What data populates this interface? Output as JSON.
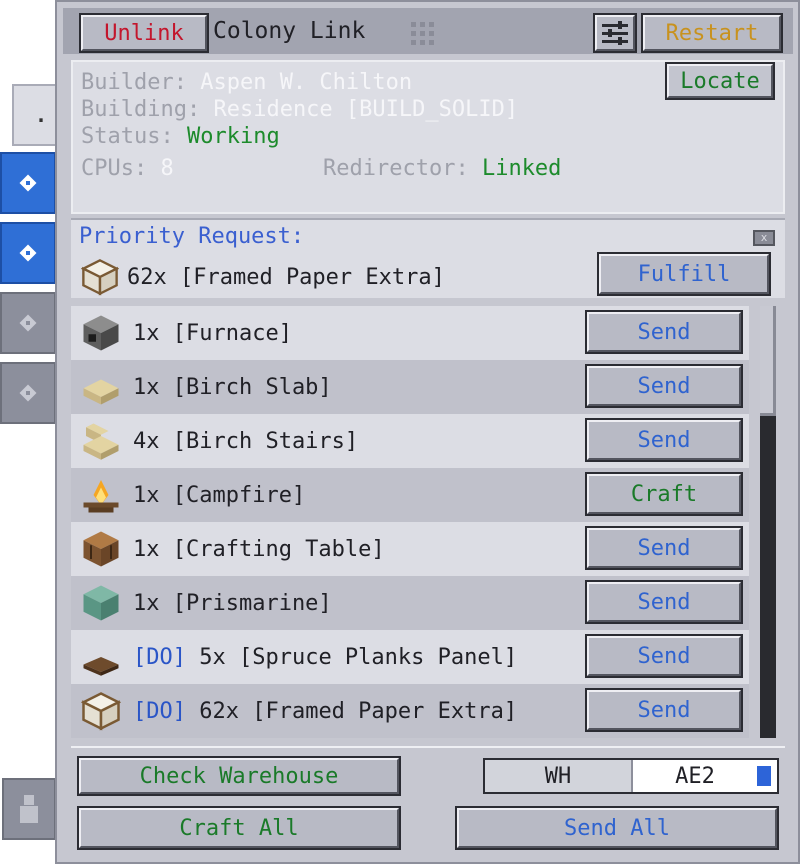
{
  "header": {
    "unlink_label": "Unlink",
    "title": "Colony Link",
    "restart_label": "Restart"
  },
  "info": {
    "builder_label": "Builder:",
    "builder_value": "Aspen W. Chilton",
    "building_label": "Building:",
    "building_value": "Residence [BUILD_SOLID]",
    "status_label": "Status:",
    "status_value": "Working",
    "cpus_label": "CPUs:",
    "cpus_value": "8",
    "redirector_label": "Redirector:",
    "redirector_value": "Linked",
    "locate_label": "Locate"
  },
  "priority": {
    "label": "Priority Request:",
    "item": "62x [Framed Paper Extra]",
    "icon": "framed-paper-icon",
    "fulfill_label": "Fulfill"
  },
  "requests": [
    {
      "tag": "",
      "text": "1x [Furnace]",
      "action": "Send",
      "icon": "furnace-icon"
    },
    {
      "tag": "",
      "text": "1x [Birch Slab]",
      "action": "Send",
      "icon": "birch-slab-icon"
    },
    {
      "tag": "",
      "text": "4x [Birch Stairs]",
      "action": "Send",
      "icon": "birch-stairs-icon"
    },
    {
      "tag": "",
      "text": "1x [Campfire]",
      "action": "Craft",
      "icon": "campfire-icon"
    },
    {
      "tag": "",
      "text": "1x [Crafting Table]",
      "action": "Send",
      "icon": "crafting-table-icon"
    },
    {
      "tag": "",
      "text": "1x [Prismarine]",
      "action": "Send",
      "icon": "prismarine-icon"
    },
    {
      "tag": "[DO]",
      "text": "5x [Spruce Planks Panel]",
      "action": "Send",
      "icon": "spruce-panel-icon"
    },
    {
      "tag": "[DO]",
      "text": "62x [Framed Paper Extra]",
      "action": "Send",
      "icon": "framed-paper-icon"
    }
  ],
  "footer": {
    "check_warehouse_label": "Check Warehouse",
    "toggle_wh": "WH",
    "toggle_ae2": "AE2",
    "craft_all_label": "Craft All",
    "send_all_label": "Send All"
  },
  "side_tabs": {
    "top_label": "."
  },
  "colors": {
    "panel": "#c6c7d0",
    "send_text": "#2f63cf",
    "craft_text": "#1a7a29",
    "unlink_text": "#c3162d",
    "restart_text": "#c8921e",
    "tab_active": "#2f6fd6"
  }
}
